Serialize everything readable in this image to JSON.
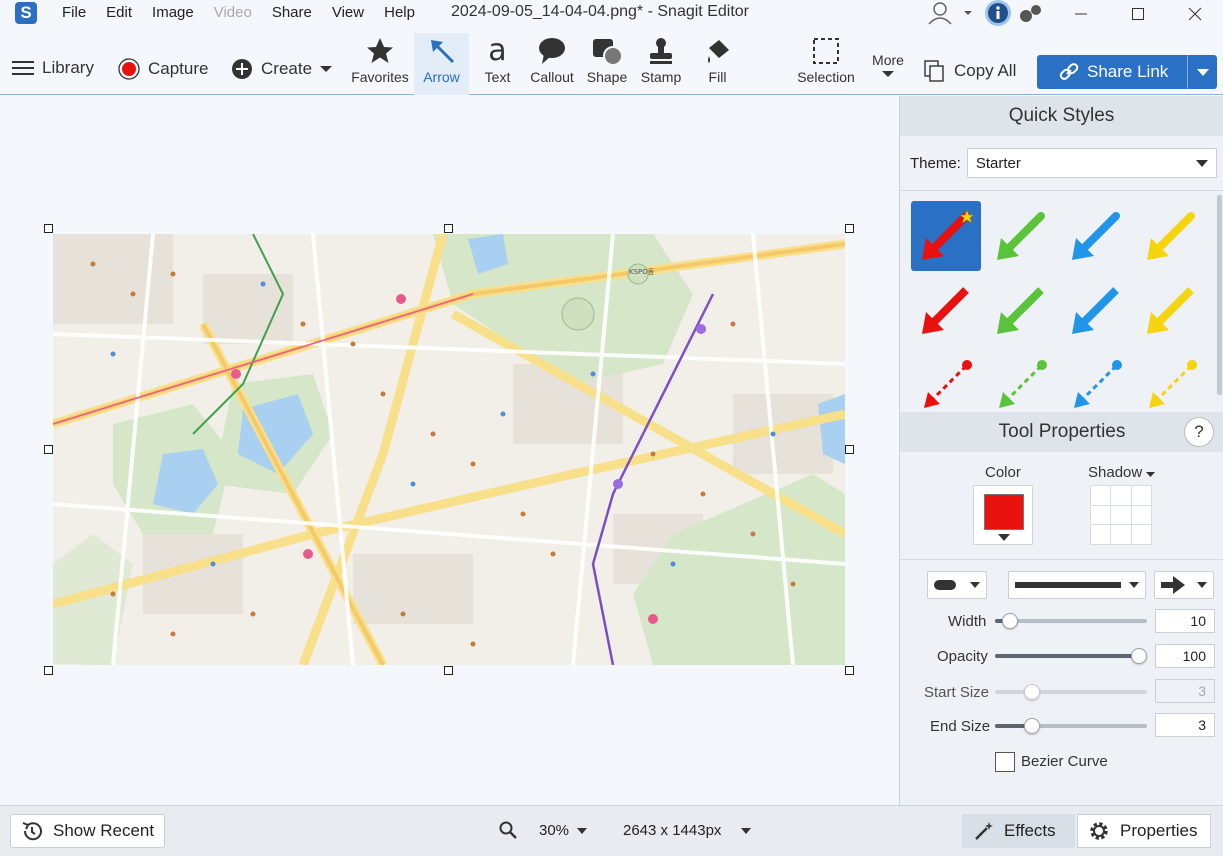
{
  "app": {
    "menu": [
      "File",
      "Edit",
      "Image",
      "Video",
      "Share",
      "View",
      "Help"
    ],
    "document_title": "2024-09-05_14-04-04.png* - Snagit Editor"
  },
  "toolbar": {
    "library": "Library",
    "capture": "Capture",
    "create": "Create",
    "tools": [
      "Favorites",
      "Arrow",
      "Text",
      "Callout",
      "Shape",
      "Stamp",
      "Fill",
      "Selection"
    ],
    "more": "More",
    "copy_all": "Copy All",
    "share_link": "Share Link"
  },
  "quick_styles": {
    "title": "Quick Styles",
    "theme_label": "Theme:",
    "theme_value": "Starter",
    "colors": [
      "#e8110e",
      "#5ac33a",
      "#2196e8",
      "#f5d410"
    ]
  },
  "tool_properties": {
    "title": "Tool Properties",
    "help": "?",
    "color_label": "Color",
    "shadow_label": "Shadow",
    "color_value": "#e8110e",
    "width_label": "Width",
    "width_value": "10",
    "width_level": 0.1,
    "opacity_label": "Opacity",
    "opacity_value": "100",
    "opacity_level": 1.0,
    "start_size_label": "Start Size",
    "start_size_value": "3",
    "end_size_label": "End Size",
    "end_size_value": "3",
    "bezier_label": "Bezier Curve"
  },
  "statusbar": {
    "show_recent": "Show Recent",
    "zoom": "30%",
    "dimensions": "2643 x 1443px",
    "effects": "Effects",
    "properties": "Properties"
  },
  "map": {
    "labels": [
      "KSPO돔"
    ]
  }
}
